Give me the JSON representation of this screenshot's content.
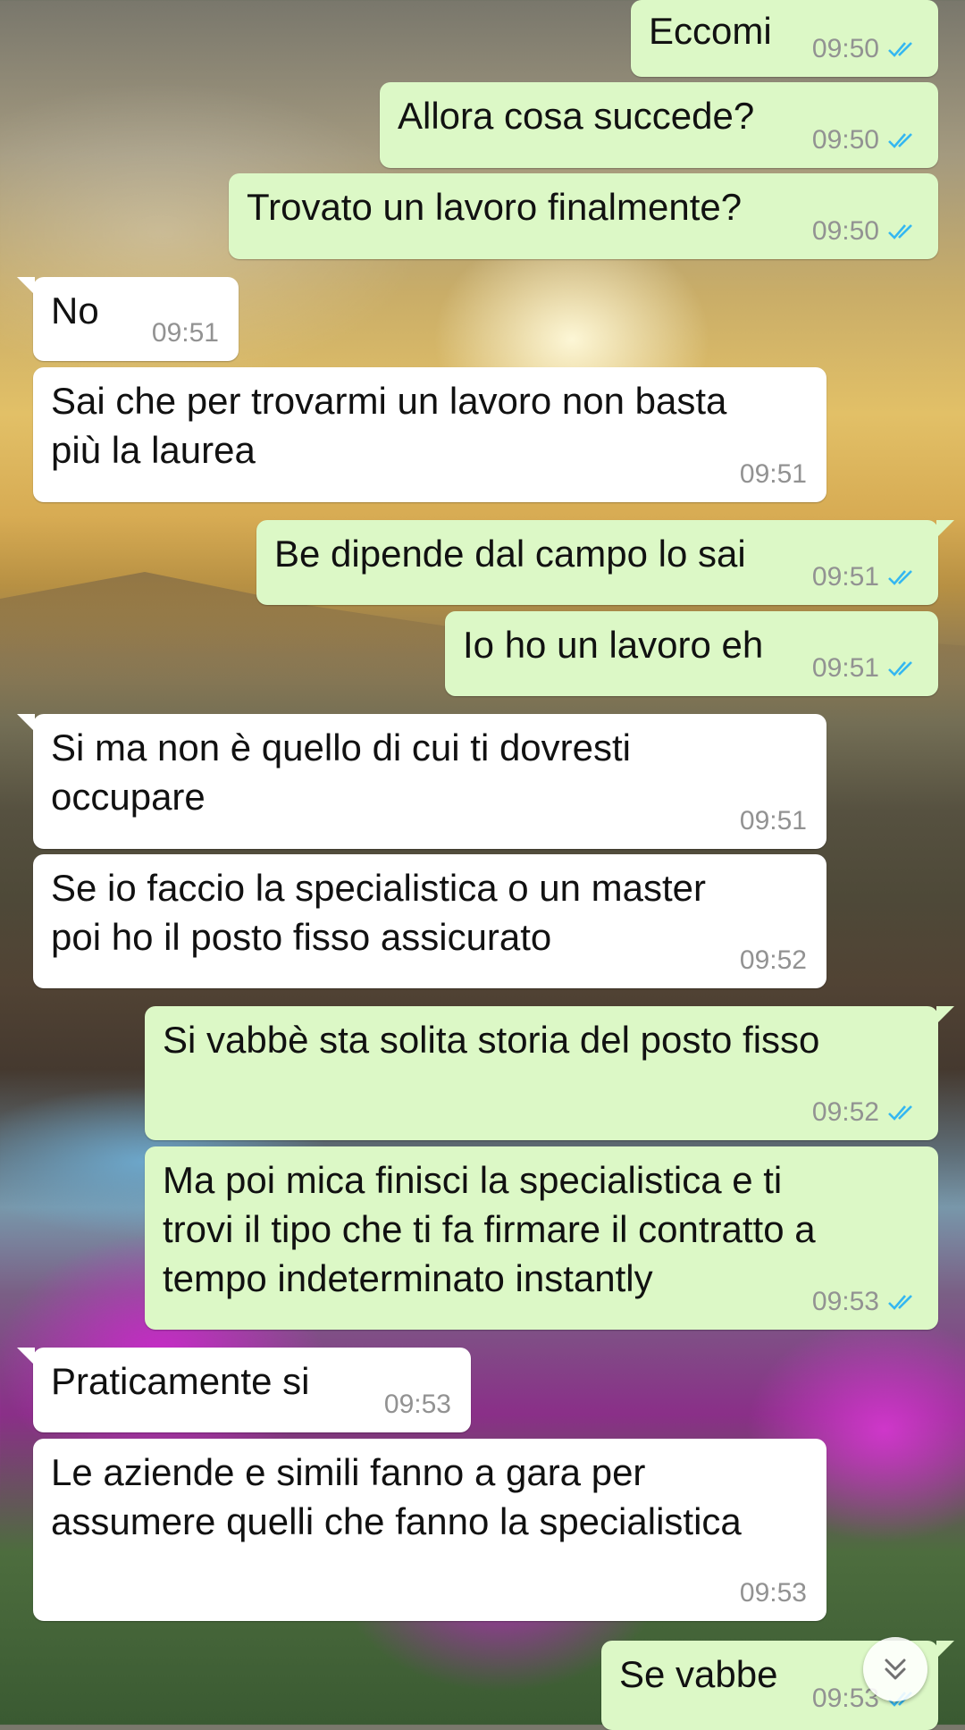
{
  "chat": {
    "messages": [
      {
        "direction": "out",
        "text": "Eccomi",
        "time": "09:50",
        "status": "read-double-check-icon"
      },
      {
        "direction": "out",
        "text": "Allora cosa succede?",
        "time": "09:50",
        "status": "read-double-check-icon"
      },
      {
        "direction": "out",
        "text": "Trovato un lavoro finalmente?",
        "time": "09:50",
        "status": "read-double-check-icon"
      },
      {
        "direction": "in",
        "text": "No",
        "time": "09:51"
      },
      {
        "direction": "in",
        "lines": [
          "Sai che per trovarmi un lavoro non basta",
          "più la laurea"
        ],
        "time": "09:51"
      },
      {
        "direction": "out",
        "text": "Be dipende dal campo lo sai",
        "time": "09:51",
        "status": "read-double-check-icon"
      },
      {
        "direction": "out",
        "text": "Io ho un lavoro eh",
        "time": "09:51",
        "status": "read-double-check-icon"
      },
      {
        "direction": "in",
        "lines": [
          "Si ma non è quello di cui ti dovresti",
          "occupare"
        ],
        "time": "09:51"
      },
      {
        "direction": "in",
        "lines": [
          "Se io faccio la specialistica o un master",
          "poi ho il posto fisso assicurato"
        ],
        "time": "09:52"
      },
      {
        "direction": "out",
        "text": "Si vabbè sta solita storia del posto fisso",
        "time": "09:52",
        "status": "read-double-check-icon"
      },
      {
        "direction": "out",
        "lines": [
          "Ma poi mica finisci la specialistica e ti",
          "trovi il tipo che ti fa firmare il contratto a",
          "tempo indeterminato instantly"
        ],
        "time": "09:53",
        "status": "read-double-check-icon"
      },
      {
        "direction": "in",
        "text": "Praticamente si",
        "time": "09:53"
      },
      {
        "direction": "in",
        "lines": [
          "Le aziende e simili fanno a gara per",
          "assumere quelli che fanno la specialistica"
        ],
        "time": "09:53"
      },
      {
        "direction": "out",
        "text": "Se vabbe",
        "time": "09:53",
        "status": "read-double-check-icon"
      }
    ]
  },
  "colors": {
    "outgoing_bubble": "#dcf8c6",
    "incoming_bubble": "#ffffff",
    "timestamp": "#929292",
    "read_ticks": "#34b7f1"
  },
  "scroll_button": {
    "icon": "double-chevron-down-icon"
  }
}
